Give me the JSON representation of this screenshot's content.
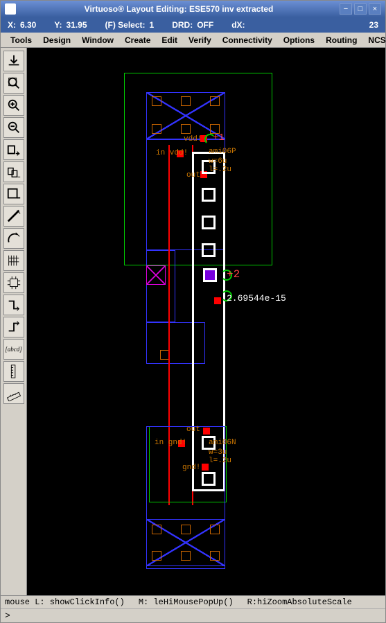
{
  "window": {
    "title": "Virtuoso® Layout Editing: ESE570 inv extracted",
    "minimize_icon": "minimize-icon",
    "maximize_icon": "maximize-icon",
    "close_icon": "close-icon"
  },
  "status": {
    "x_label": "X:",
    "x_val": "6.30",
    "y_label": "Y:",
    "y_val": "31.95",
    "sel_label": "(F) Select:",
    "sel_val": "1",
    "drd_label": "DRD:",
    "drd_val": "OFF",
    "dx_label": "dX:",
    "right_num": "23"
  },
  "menu": [
    "Tools",
    "Design",
    "Window",
    "Create",
    "Edit",
    "Verify",
    "Connectivity",
    "Options",
    "Routing",
    "NCSU"
  ],
  "toolbar": [
    "save-icon",
    "fit-icon",
    "zoom-in-icon",
    "zoom-out-icon",
    "stretch-icon",
    "copy-icon",
    "layer-icon",
    "path-icon",
    "arc-icon",
    "pattern-icon",
    "device-icon",
    "wire-down-icon",
    "wire-up-icon",
    "abcd-icon",
    "ruler-v-icon",
    "ruler-icon"
  ],
  "canvas": {
    "annotations": {
      "plus1": "+1",
      "vdd": "vdd!",
      "in_top": "in vdd!",
      "ami06p": "ami06P",
      "w6u": "w=6u",
      "l2u_top": "l=.2u",
      "out_top": "out",
      "plus2": "+2",
      "cap_val": "2.69544e-15",
      "out_bot": "out",
      "in_bot": "in gnd!",
      "ami06n": "ami06N",
      "w3u": "w=3u",
      "l2u_bot": "l=.2u",
      "gnd": "gnd!"
    }
  },
  "bottom": {
    "mouse_l": "mouse L: showClickInfo()",
    "mouse_m": "M: leHiMousePopUp()",
    "mouse_r": "R:hiZoomAbsoluteScale"
  },
  "prompt": ">"
}
